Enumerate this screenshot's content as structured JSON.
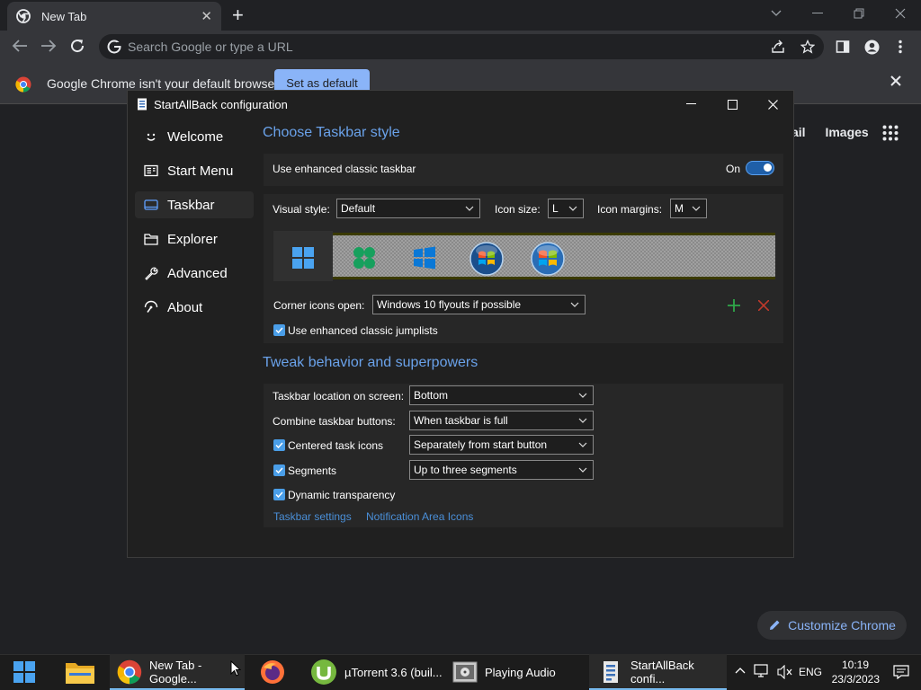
{
  "chrome": {
    "tab_title": "New Tab",
    "omnibox_placeholder": "Search Google or type a URL",
    "infobar_text": "Google Chrome isn't your default browser",
    "set_default_label": "Set as default",
    "ntp_links": [
      "ail",
      "Images"
    ],
    "customize_label": "Customize Chrome"
  },
  "dialog": {
    "title": "StartAllBack configuration",
    "nav": [
      {
        "label": "Welcome",
        "icon": "smile-icon"
      },
      {
        "label": "Start Menu",
        "icon": "start-menu-icon"
      },
      {
        "label": "Taskbar",
        "icon": "taskbar-icon"
      },
      {
        "label": "Explorer",
        "icon": "folder-icon"
      },
      {
        "label": "Advanced",
        "icon": "wrench-icon"
      },
      {
        "label": "About",
        "icon": "about-icon"
      }
    ],
    "selected_nav": "Taskbar",
    "section1_title": "Choose Taskbar style",
    "enhanced_taskbar_label": "Use enhanced classic taskbar",
    "toggle_state": "On",
    "visual_style_label": "Visual style:",
    "visual_style_value": "Default",
    "icon_size_label": "Icon size:",
    "icon_size_value": "L",
    "icon_margins_label": "Icon margins:",
    "icon_margins_value": "M",
    "corner_icons_label": "Corner icons open:",
    "corner_icons_value": "Windows 10 flyouts if possible",
    "jumplists_label": "Use enhanced classic jumplists",
    "section2_title": "Tweak behavior and superpowers",
    "location_label": "Taskbar location on screen:",
    "location_value": "Bottom",
    "combine_label": "Combine taskbar buttons:",
    "combine_value": "When taskbar is full",
    "centered_label": "Centered task icons",
    "centered_value": "Separately from start button",
    "segments_label": "Segments",
    "segments_value": "Up to three segments",
    "transparency_label": "Dynamic transparency",
    "link_taskbar_settings": "Taskbar settings",
    "link_notification_icons": "Notification Area Icons"
  },
  "taskbar": {
    "items": [
      {
        "label": "New Tab - Google...",
        "icon": "chrome-icon"
      },
      {
        "label": "",
        "icon": "firefox-icon"
      },
      {
        "label": "µTorrent 3.6  (buil...",
        "icon": "utorrent-icon"
      },
      {
        "label": "Playing Audio",
        "icon": "audio-player-icon"
      },
      {
        "label": "StartAllBack confi...",
        "icon": "startallback-icon"
      }
    ],
    "language": "ENG",
    "time": "10:19",
    "date": "23/3/2023"
  }
}
